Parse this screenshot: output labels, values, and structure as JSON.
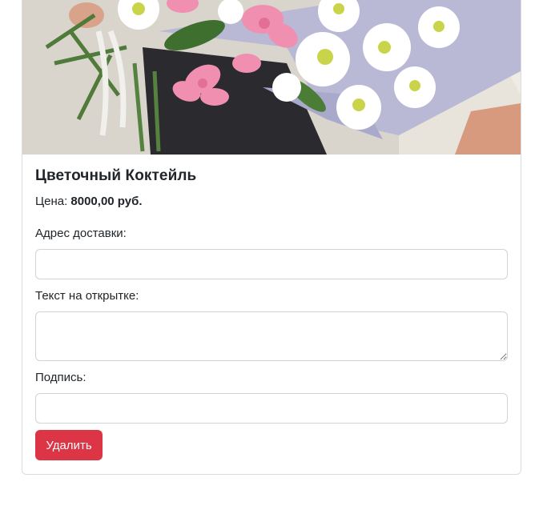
{
  "product": {
    "title": "Цветочный Коктейль",
    "price_label": "Цена:",
    "price_value": "8000,00 руб."
  },
  "form": {
    "address_label": "Адрес доставки:",
    "address_value": "",
    "card_text_label": "Текст на открытке:",
    "card_text_value": "",
    "signature_label": "Подпись:",
    "signature_value": ""
  },
  "actions": {
    "delete_label": "Удалить"
  },
  "colors": {
    "danger": "#dc3545",
    "border": "#ced4da"
  }
}
